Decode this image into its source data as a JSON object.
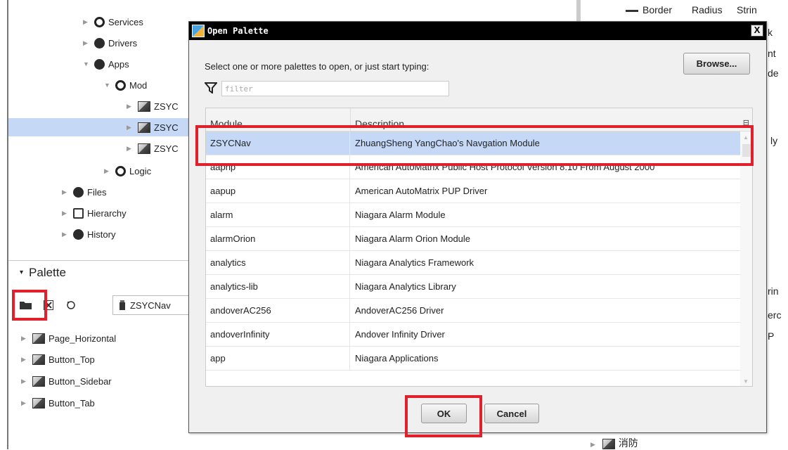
{
  "nav_tree": {
    "items": [
      {
        "label": "Services",
        "icon": "services-icon"
      },
      {
        "label": "Drivers",
        "icon": "drivers-icon"
      },
      {
        "label": "Apps",
        "icon": "apps-icon"
      },
      {
        "label": "Mod",
        "icon": "folder-circle-icon"
      },
      {
        "label": "ZSYC",
        "icon": "component-icon"
      },
      {
        "label": "ZSYC",
        "icon": "component-icon"
      },
      {
        "label": "ZSYC",
        "icon": "component-icon"
      },
      {
        "label": "Logic",
        "icon": "folder-circle-icon"
      },
      {
        "label": "Files",
        "icon": "files-icon"
      },
      {
        "label": "Hierarchy",
        "icon": "hierarchy-icon"
      },
      {
        "label": "History",
        "icon": "history-icon"
      }
    ]
  },
  "palette": {
    "title": "Palette",
    "selected_module": "ZSYCNav",
    "items": [
      {
        "label": "Page_Horizontal"
      },
      {
        "label": "Button_Top"
      },
      {
        "label": "Button_Sidebar"
      },
      {
        "label": "Button_Tab"
      }
    ]
  },
  "background_right": {
    "header": [
      "Border",
      "Radius",
      "Strin"
    ],
    "fragments": [
      "k",
      "nt",
      "de",
      "ly",
      "rin",
      "erc",
      "P"
    ],
    "bottom_item": "消防"
  },
  "dialog": {
    "title": "Open Palette",
    "close_label": "X",
    "instruction": "Select one or more palettes to open, or just start typing:",
    "browse_label": "Browse...",
    "filter_placeholder": "filter",
    "columns": {
      "module": "Module",
      "description": "Description"
    },
    "rows": [
      {
        "module": "ZSYCNav",
        "description": "ZhuangSheng YangChao's Navgation Module",
        "selected": true
      },
      {
        "module": "aaphp",
        "description": "American AutoMatrix Public Host Protocol Version 8.10 From August 2000"
      },
      {
        "module": "aapup",
        "description": "American AutoMatrix PUP Driver"
      },
      {
        "module": "alarm",
        "description": "Niagara Alarm Module"
      },
      {
        "module": "alarmOrion",
        "description": "Niagara Alarm Orion Module"
      },
      {
        "module": "analytics",
        "description": "Niagara Analytics Framework"
      },
      {
        "module": "analytics-lib",
        "description": "Niagara Analytics Library"
      },
      {
        "module": "andoverAC256",
        "description": "AndoverAC256 Driver"
      },
      {
        "module": "andoverInfinity",
        "description": "Andover Infinity Driver"
      },
      {
        "module": "app",
        "description": "Niagara Applications"
      }
    ],
    "ok_label": "OK",
    "cancel_label": "Cancel"
  },
  "colors": {
    "highlight": "#e0212b",
    "selection": "#c5d9f6"
  }
}
